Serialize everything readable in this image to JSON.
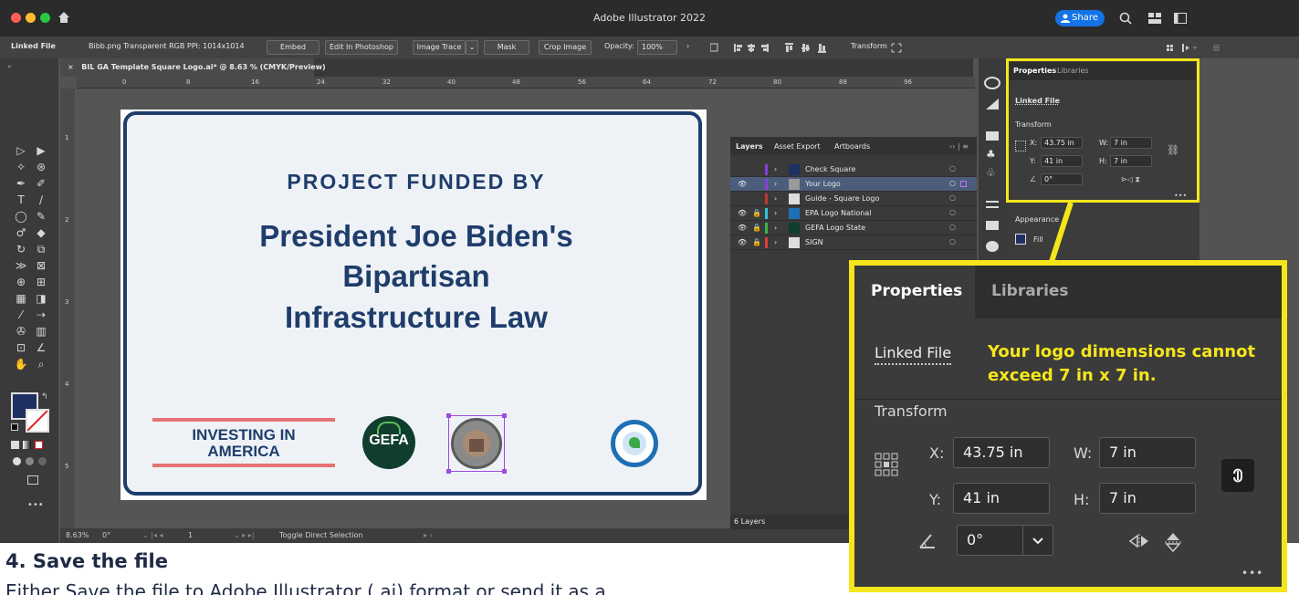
{
  "window": {
    "title": "Adobe Illustrator 2022",
    "share_label": "Share"
  },
  "control_bar": {
    "linked_file": "Linked File",
    "file_info": "Bibb.png  Transparent RGB  PPI: 1014x1014",
    "embed": "Embed",
    "edit_in_photoshop": "Edit In Photoshop",
    "image_trace": "Image Trace",
    "mask": "Mask",
    "crop_image": "Crop Image",
    "opacity_label": "Opacity:",
    "opacity_value": "100%",
    "transform": "Transform"
  },
  "document_tab": {
    "close": "×",
    "title": "BIL GA Template Square Logo.ai* @ 8.63 % (CMYK/Preview)"
  },
  "ruler": {
    "ticks": [
      "0",
      "8",
      "16",
      "24",
      "32",
      "40",
      "48",
      "56",
      "64",
      "72",
      "80",
      "88",
      "96"
    ]
  },
  "vertical_ruler": {
    "ticks": [
      "1",
      "2",
      "3",
      "4",
      "5"
    ]
  },
  "artboard": {
    "headline": "PROJECT FUNDED BY",
    "title_lines": [
      "President Joe Biden's",
      "Bipartisan",
      "Infrastructure Law"
    ],
    "investing_line1": "INVESTING IN",
    "investing_line2": "AMERICA",
    "gefa": "GEFA"
  },
  "status_bar": {
    "zoom": "8.63%",
    "rotation": "0°",
    "artboard_num": "1",
    "tool_hint": "Toggle Direct Selection"
  },
  "layers_panel": {
    "tabs": [
      "Layers",
      "Asset Export",
      "Artboards"
    ],
    "rows": [
      {
        "name": "Check Square",
        "color": "#8b3fd9",
        "selected": false
      },
      {
        "name": "Your Logo",
        "color": "#8b3fd9",
        "selected": true
      },
      {
        "name": "Guide - Square Logo",
        "color": "#c0392b",
        "selected": false
      },
      {
        "name": "EPA Logo National",
        "color": "#2ec4d6",
        "selected": false
      },
      {
        "name": "GEFA Logo State",
        "color": "#3fb54a",
        "selected": false
      },
      {
        "name": "SIGN",
        "color": "#e03b3b",
        "selected": false
      }
    ],
    "count": "6 Layers"
  },
  "properties_panel": {
    "tabs": [
      "Properties",
      "Libraries"
    ],
    "linked_file": "Linked File",
    "transform": "Transform",
    "x_label": "X:",
    "x_value": "43.75 in",
    "y_label": "Y:",
    "y_value": "41 in",
    "w_label": "W:",
    "w_value": "7 in",
    "h_label": "H:",
    "h_value": "7 in",
    "angle_value": "0°",
    "appearance": "Appearance",
    "fill": "Fill",
    "more": "•••"
  },
  "zoom_callout": {
    "tabs": [
      "Properties",
      "Libraries"
    ],
    "linked_file": "Linked File",
    "note": "Your logo dimensions cannot exceed 7 in x 7 in.",
    "transform": "Transform",
    "x_label": "X:",
    "x_value": "43.75 in",
    "y_label": "Y:",
    "y_value": "41 in",
    "w_label": "W:",
    "w_value": "7 in",
    "h_label": "H:",
    "h_value": "7 in",
    "angle_value": "0°",
    "more": "•••"
  },
  "doc_text": {
    "step_title": "4. Save the file",
    "step_body": "Either Save the file to Adobe Illustrator (.ai) format or send it as a"
  },
  "colors": {
    "highlight": "#f5e61b",
    "brand_navy": "#1f3d6b",
    "accent_red": "#e57373",
    "share_blue": "#1473e6"
  }
}
